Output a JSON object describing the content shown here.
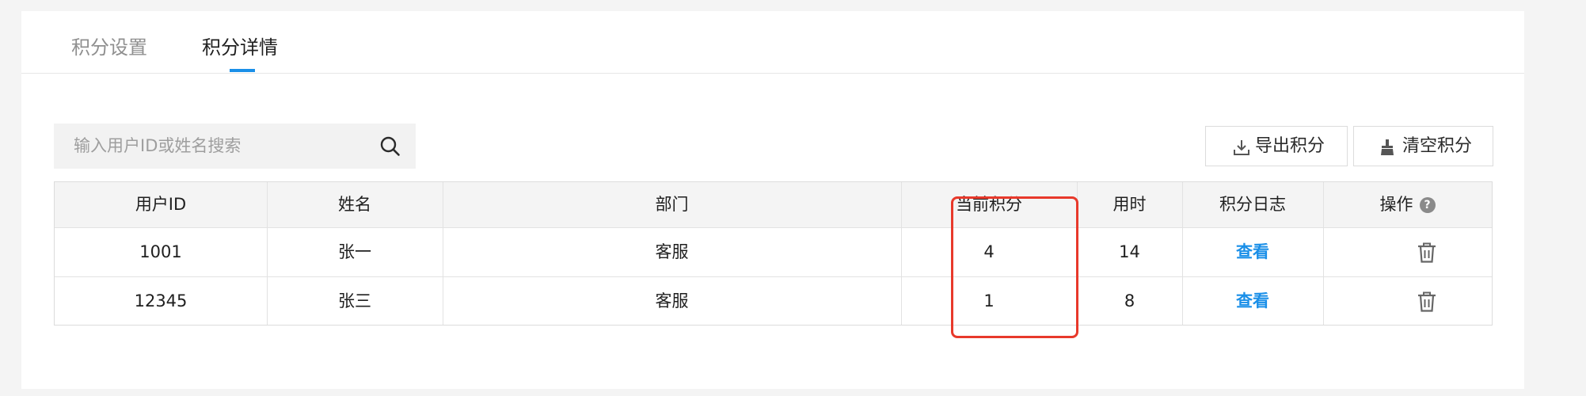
{
  "tabs": [
    {
      "label": "积分设置",
      "active": false
    },
    {
      "label": "积分详情",
      "active": true
    }
  ],
  "search": {
    "placeholder": "输入用户ID或姓名搜索",
    "icon": "search-icon"
  },
  "toolbar": {
    "export_label": "导出积分",
    "export_icon": "download-icon",
    "clear_label": "清空积分",
    "clear_icon": "broom-icon"
  },
  "table": {
    "headers": {
      "user_id": "用户ID",
      "name": "姓名",
      "department": "部门",
      "current_points": "当前积分",
      "time_used": "用时",
      "points_log": "积分日志",
      "actions": "操作"
    },
    "actions_help_icon": "help-icon",
    "rows": [
      {
        "user_id": "1001",
        "name": "张一",
        "department": "客服",
        "current_points": "4",
        "time_used": "14",
        "log_link": "查看",
        "action_icon": "trash-icon"
      },
      {
        "user_id": "12345",
        "name": "张三",
        "department": "客服",
        "current_points": "1",
        "time_used": "8",
        "log_link": "查看",
        "action_icon": "trash-icon"
      }
    ]
  },
  "colors": {
    "accent": "#1a8fe8",
    "highlight": "#e8392b",
    "background": "#f4f4f4",
    "panel": "#ffffff"
  }
}
